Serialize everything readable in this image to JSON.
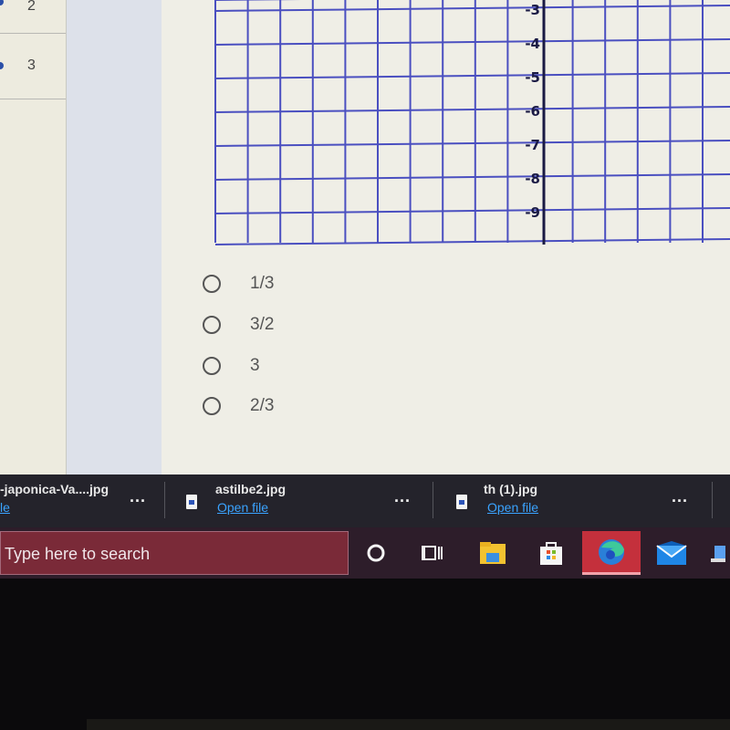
{
  "left_nav": {
    "items": [
      {
        "label": "2"
      },
      {
        "label": "3"
      }
    ]
  },
  "graph": {
    "y_axis_labels": [
      "-3",
      "-4",
      "-5",
      "-6",
      "-7",
      "-8",
      "-9"
    ],
    "grid_color": "#4a4fc0",
    "axis_color": "#1a1a44"
  },
  "question": {
    "choices": [
      {
        "label": "1/3",
        "selected": false
      },
      {
        "label": "3/2",
        "selected": false
      },
      {
        "label": "3",
        "selected": false
      },
      {
        "label": "2/3",
        "selected": false
      }
    ]
  },
  "downloads_bar": {
    "items": [
      {
        "name": "-japonica-Va....jpg",
        "link": "le"
      },
      {
        "name": "astilbe2.jpg",
        "link": "Open file"
      },
      {
        "name": "th (1).jpg",
        "link": "Open file"
      }
    ],
    "more_label": "..."
  },
  "taskbar": {
    "search_placeholder": "Type here to search",
    "icons": [
      "cortana-icon",
      "task-view-icon",
      "file-explorer-icon",
      "store-icon",
      "edge-icon",
      "mail-icon"
    ],
    "active_icon": "edge-icon"
  }
}
